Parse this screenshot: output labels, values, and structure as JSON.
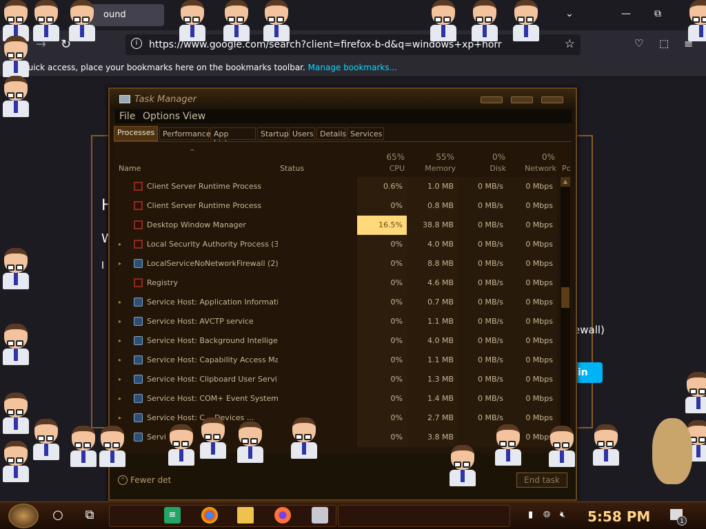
{
  "browser": {
    "tab_title": "ound",
    "url": "https://www.google.com/search?client=firefox-b-d&q=windows+xp+horr",
    "bookmarks_hint": "quick access, place your bookmarks here on the bookmarks toolbar.",
    "bookmarks_link": "Manage bookmarks..."
  },
  "page": {
    "fragment_1": "H",
    "fragment_2": "W",
    "fragment_3": "I",
    "fragment_4": "ewall)",
    "button_text": "in"
  },
  "task_manager": {
    "title": "Task Manager",
    "menu": [
      "File",
      "Options",
      "View"
    ],
    "tabs": [
      "Processes",
      "Performance",
      "App history",
      "Startup",
      "Users",
      "Details",
      "Services"
    ],
    "active_tab": "Processes",
    "columns": {
      "name": "Name",
      "status": "Status",
      "cpu_pct": "65%",
      "cpu": "CPU",
      "memory_pct": "55%",
      "memory": "Memory",
      "disk_pct": "0%",
      "disk": "Disk",
      "network_pct": "0%",
      "network": "Network",
      "power_cut": "Pc"
    },
    "processes": [
      {
        "name": "Client Server Runtime Process",
        "icon": "window-frame-icon",
        "expandable": false,
        "cpu": "0.6%",
        "memory": "1.0 MB",
        "disk": "0 MB/s",
        "network": "0 Mbps"
      },
      {
        "name": "Client Server Runtime Process",
        "icon": "window-frame-icon",
        "expandable": false,
        "cpu": "0%",
        "memory": "0.8 MB",
        "disk": "0 MB/s",
        "network": "0 Mbps"
      },
      {
        "name": "Desktop Window Manager",
        "icon": "window-frame-icon",
        "expandable": false,
        "cpu": "16.5%",
        "memory": "38.8 MB",
        "disk": "0 MB/s",
        "network": "0 Mbps",
        "cpu_highlight": true
      },
      {
        "name": "Local Security Authority Process (3)",
        "icon": "window-frame-icon",
        "expandable": true,
        "cpu": "0%",
        "memory": "4.0 MB",
        "disk": "0 MB/s",
        "network": "0 Mbps"
      },
      {
        "name": "LocalServiceNoNetworkFirewall (2)",
        "icon": "gear-icon",
        "expandable": true,
        "cpu": "0%",
        "memory": "8.8 MB",
        "disk": "0 MB/s",
        "network": "0 Mbps"
      },
      {
        "name": "Registry",
        "icon": "window-frame-icon",
        "expandable": false,
        "cpu": "0%",
        "memory": "4.6 MB",
        "disk": "0 MB/s",
        "network": "0 Mbps"
      },
      {
        "name": "Service Host: Application Information",
        "icon": "gear-icon",
        "expandable": true,
        "cpu": "0%",
        "memory": "0.7 MB",
        "disk": "0 MB/s",
        "network": "0 Mbps"
      },
      {
        "name": "Service Host: AVCTP service",
        "icon": "gear-icon",
        "expandable": true,
        "cpu": "0%",
        "memory": "1.1 MB",
        "disk": "0 MB/s",
        "network": "0 Mbps"
      },
      {
        "name": "Service Host: Background Intelligen...",
        "icon": "gear-icon",
        "expandable": true,
        "cpu": "0%",
        "memory": "4.0 MB",
        "disk": "0 MB/s",
        "network": "0 Mbps"
      },
      {
        "name": "Service Host: Capability Access Ma...",
        "icon": "gear-icon",
        "expandable": true,
        "cpu": "0%",
        "memory": "1.1 MB",
        "disk": "0 MB/s",
        "network": "0 Mbps"
      },
      {
        "name": "Service Host: Clipboard User Servi...",
        "icon": "gear-icon",
        "expandable": true,
        "cpu": "0%",
        "memory": "1.3 MB",
        "disk": "0 MB/s",
        "network": "0 Mbps"
      },
      {
        "name": "Service Host: COM+ Event System",
        "icon": "gear-icon",
        "expandable": true,
        "cpu": "0%",
        "memory": "1.4 MB",
        "disk": "0 MB/s",
        "network": "0 Mbps"
      },
      {
        "name": "Service Host: C... Devices ...",
        "icon": "gear-icon",
        "expandable": true,
        "cpu": "0%",
        "memory": "2.7 MB",
        "disk": "0 MB/s",
        "network": "0 Mbps"
      },
      {
        "name": "Servi",
        "icon": "gear-icon",
        "expandable": true,
        "cpu": "0%",
        "memory": "3.8 MB",
        "disk": "0",
        "network": "0 Mbps"
      }
    ],
    "footer": {
      "fewer_details": "Fewer det",
      "end_task": "End task"
    }
  },
  "taskbar": {
    "clock": "5:58 PM",
    "notification_count": "1",
    "apps": [
      "search-icon",
      "task-view-icon",
      "sheets-icon",
      "chrome-icon",
      "file-explorer-icon",
      "firefox-icon",
      "app-icon"
    ]
  },
  "colors": {
    "cpu_highlight": "#ffd97a",
    "accent_link": "#00ddff",
    "clock": "#ffd48a"
  }
}
